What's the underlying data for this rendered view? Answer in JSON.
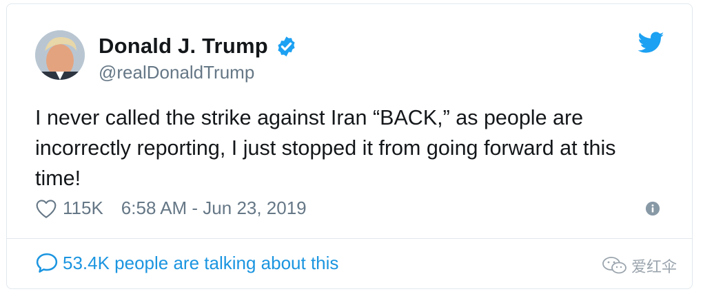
{
  "tweet": {
    "author_name": "Donald J. Trump",
    "author_handle": "@realDonaldTrump",
    "text": "I never called the strike against Iran “BACK,” as people are incorrectly reporting, I just stopped it from going forward at this time!",
    "likes": "115K",
    "timestamp": "6:58 AM - Jun 23, 2019",
    "talking": "53.4K people are talking about this"
  },
  "watermark": {
    "text": "爱红伞"
  },
  "icons": {
    "verified": "verified-badge-icon",
    "brand": "twitter-bird-icon",
    "like": "heart-icon",
    "info": "info-icon",
    "reply": "speech-bubble-icon",
    "watermark": "wechat-icon"
  },
  "colors": {
    "accent": "#1da1f2",
    "link": "#1b95e0",
    "muted": "#657786",
    "text": "#14171a"
  }
}
